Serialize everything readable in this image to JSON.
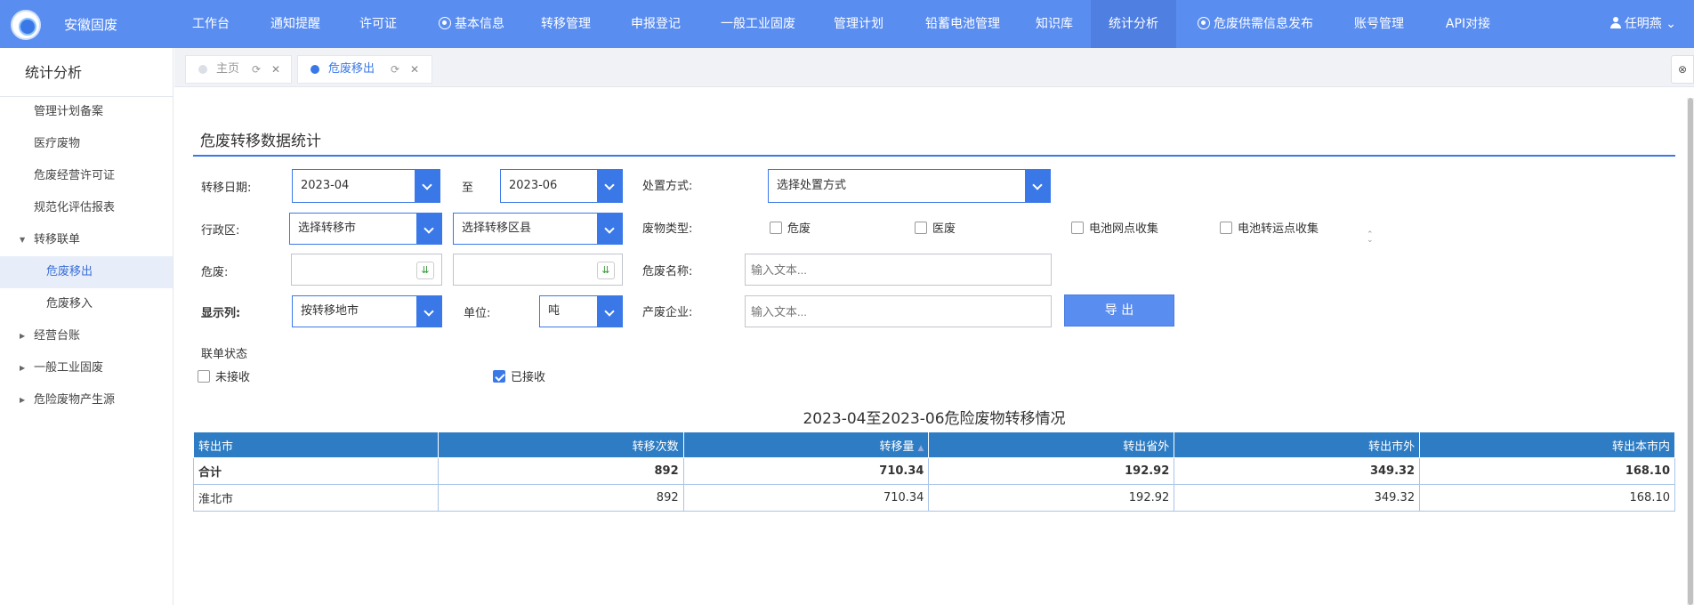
{
  "header": {
    "brand": "安徽固废",
    "nav": [
      "工作台",
      "通知提醒",
      "许可证",
      "基本信息",
      "转移管理",
      "申报登记",
      "一般工业固废",
      "管理计划",
      "铅蓄电池管理",
      "知识库",
      "统计分析",
      "危废供需信息发布",
      "账号管理",
      "API对接"
    ],
    "active_nav": "统计分析",
    "user": "任明燕"
  },
  "sidebar": {
    "title": "统计分析",
    "items": [
      "管理计划备案",
      "医疗废物",
      "危废经营许可证",
      "规范化评估报表",
      "转移联单",
      "危废移出",
      "危废移入",
      "经营台账",
      "一般工业固废",
      "危险废物产生源"
    ]
  },
  "tabs": [
    {
      "label": "主页"
    },
    {
      "label": "危废移出"
    }
  ],
  "form": {
    "section_title": "危废转移数据统计",
    "date_label": "转移日期:",
    "date_from": "2023-04",
    "date_to_label": "至",
    "date_to": "2023-06",
    "disposal_label": "处置方式:",
    "disposal_value": "选择处置方式",
    "region_label": "行政区:",
    "city_value": "选择转移市",
    "county_value": "选择转移区县",
    "waste_type_label": "废物类型:",
    "waste_types": [
      "危废",
      "医废",
      "电池网点收集",
      "电池转运点收集"
    ],
    "hazard_label": "危废:",
    "hazard_name_label": "危废名称:",
    "hazard_name_placeholder": "输入文本...",
    "display_label": "显示列:",
    "display_value": "按转移地市",
    "unit_label": "单位:",
    "unit_value": "吨",
    "producer_label": "产废企业:",
    "producer_placeholder": "输入文本...",
    "export_label": "导 出",
    "status_label": "联单状态",
    "status_options": [
      {
        "label": "未接收",
        "checked": false
      },
      {
        "label": "已接收",
        "checked": true
      }
    ]
  },
  "table": {
    "title": "2023-04至2023-06危险废物转移情况",
    "headers": [
      "转出市",
      "转移次数",
      "转移量",
      "转出省外",
      "转出市外",
      "转出本市内"
    ],
    "rows": [
      [
        "合计",
        "892",
        "710.34",
        "192.92",
        "349.32",
        "168.10"
      ],
      [
        "淮北市",
        "892",
        "710.34",
        "192.92",
        "349.32",
        "168.10"
      ]
    ]
  }
}
